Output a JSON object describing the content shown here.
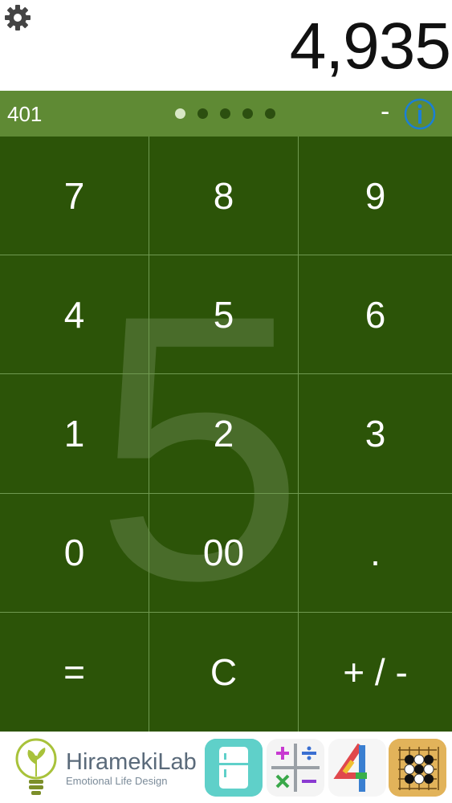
{
  "display": {
    "value": "4,935",
    "settings_icon": "gear-icon"
  },
  "status": {
    "memory": "401",
    "page_dots": 5,
    "active_dot": 0,
    "operator": "-",
    "info_icon": "info-icon"
  },
  "keypad": {
    "overlay_digit": "5",
    "keys": [
      "7",
      "8",
      "9",
      "4",
      "5",
      "6",
      "1",
      "2",
      "3",
      "0",
      "00",
      ".",
      "=",
      "C",
      "+ / -"
    ]
  },
  "banner": {
    "brand": "HiramekiLab",
    "tagline": "Emotional Life Design",
    "apps": [
      "fridge-app-icon",
      "math-operators-app-icon",
      "number-four-app-icon",
      "go-game-app-icon"
    ]
  },
  "colors": {
    "status_bar": "#5f8a34",
    "keypad": "#2c5408",
    "info_blue": "#1a7fd6"
  }
}
